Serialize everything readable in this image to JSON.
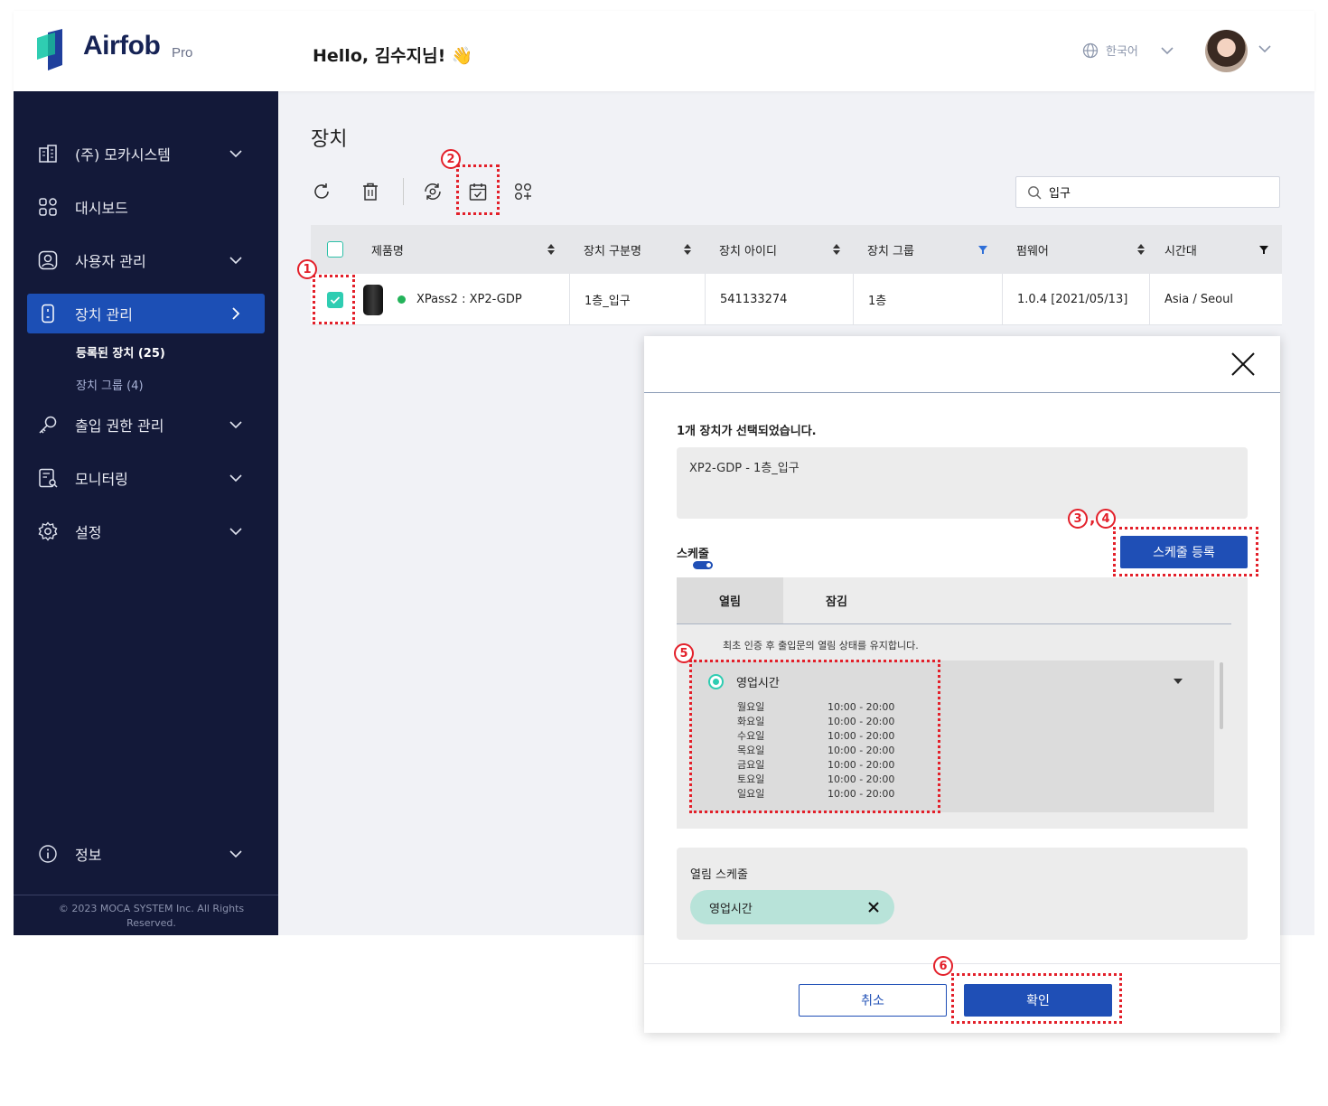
{
  "brand": {
    "name": "Airfob",
    "tier": "Pro",
    "accent": "#1f4fb6",
    "sidebar_bg": "#131939"
  },
  "header": {
    "greeting": "Hello, 김수지님! 👋",
    "language": "한국어"
  },
  "sidebar": {
    "items": [
      {
        "label": "(주) 모카시스템",
        "icon": "building-icon"
      },
      {
        "label": "대시보드",
        "icon": "dashboard-icon"
      },
      {
        "label": "사용자 관리",
        "icon": "user-icon"
      },
      {
        "label": "장치 관리",
        "icon": "device-icon"
      },
      {
        "label": "출입 권한 관리",
        "icon": "key-icon"
      },
      {
        "label": "모니터링",
        "icon": "monitor-icon"
      },
      {
        "label": "설정",
        "icon": "gear-icon"
      }
    ],
    "subitems": [
      {
        "label": "등록된 장치 (25)"
      },
      {
        "label": "장치 그룹  (4)"
      }
    ],
    "info": "정보",
    "copyright": "© 2023 MOCA SYSTEM Inc. All Rights Reserved."
  },
  "page": {
    "title": "장치"
  },
  "search": {
    "value": "입구"
  },
  "table": {
    "columns": [
      "제품명",
      "장치 구분명",
      "장치 아이디",
      "장치 그룹",
      "펌웨어",
      "시간대"
    ],
    "rows": [
      {
        "product": "XPass2 : XP2-GDP",
        "name": "1층_입구",
        "id": "541133274",
        "group": "1층",
        "firmware": "1.0.4 [2021/05/13]",
        "timezone": "Asia / Seoul",
        "status": "online"
      }
    ]
  },
  "annotations": {
    "n1": "1",
    "n2": "2",
    "n3": "3",
    "n4": "4",
    "n5": "5",
    "n6": "6"
  },
  "modal": {
    "selected_text": "1개 장치가 선택되었습니다.",
    "selected_device": "XP2-GDP - 1층_입구",
    "schedule_label": "스케줄",
    "register_button": "스케줄 등록",
    "tabs": [
      "열림",
      "잠김"
    ],
    "description": "최초 인증 후 출입문의 열림 상태를 유지합니다.",
    "schedule": {
      "name": "영업시간",
      "days": [
        {
          "day": "월요일",
          "time": "10:00 - 20:00"
        },
        {
          "day": "화요일",
          "time": "10:00 - 20:00"
        },
        {
          "day": "수요일",
          "time": "10:00 - 20:00"
        },
        {
          "day": "목요일",
          "time": "10:00 - 20:00"
        },
        {
          "day": "금요일",
          "time": "10:00 - 20:00"
        },
        {
          "day": "토요일",
          "time": "10:00 - 20:00"
        },
        {
          "day": "일요일",
          "time": "10:00 - 20:00"
        }
      ]
    },
    "open_schedule_label": "열림 스케줄",
    "chip": "영업시간",
    "cancel": "취소",
    "confirm": "확인"
  }
}
